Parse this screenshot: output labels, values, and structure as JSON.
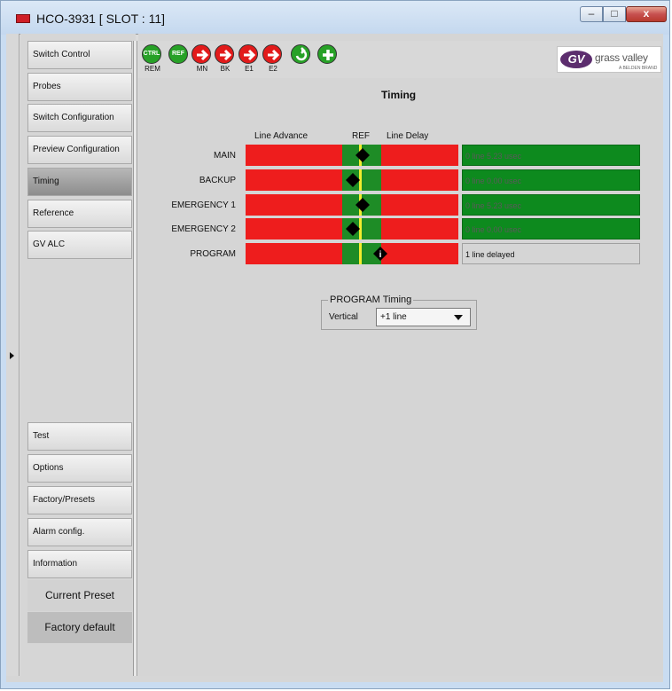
{
  "window": {
    "title": "HCO-3931 [ SLOT : 11]",
    "min_glyph": "–",
    "max_glyph": "□",
    "close_glyph": "x"
  },
  "nav": {
    "top_items": [
      {
        "label": "Switch Control",
        "active": false
      },
      {
        "label": "Probes",
        "active": false
      },
      {
        "label": "Switch Configuration",
        "active": false
      },
      {
        "label": "Preview Configuration",
        "active": false
      },
      {
        "label": "Timing",
        "active": true
      },
      {
        "label": "Reference",
        "active": false
      },
      {
        "label": "GV ALC",
        "active": false
      }
    ],
    "bottom_items": [
      {
        "label": "Test"
      },
      {
        "label": "Options"
      },
      {
        "label": "Factory/Presets"
      },
      {
        "label": "Alarm config."
      },
      {
        "label": "Information"
      }
    ],
    "current_preset": "Current Preset",
    "factory_default": "Factory default"
  },
  "toolbar": {
    "indicators": [
      {
        "name": "ctrl-indicator",
        "text": "CTRL",
        "label": "REM",
        "color": "#27a127",
        "icon": "circle-text"
      },
      {
        "name": "ref-indicator",
        "text": "REF",
        "label": "",
        "color": "#27a127",
        "icon": "circle-text"
      },
      {
        "name": "main-input-indicator",
        "text": "",
        "label": "MN",
        "color": "#e21b1b",
        "icon": "arrow-right"
      },
      {
        "name": "backup-input-indicator",
        "text": "",
        "label": "BK",
        "color": "#e21b1b",
        "icon": "arrow-right"
      },
      {
        "name": "emergency1-input-indicator",
        "text": "",
        "label": "E1",
        "color": "#e21b1b",
        "icon": "arrow-right"
      },
      {
        "name": "emergency2-input-indicator",
        "text": "",
        "label": "E2",
        "color": "#e21b1b",
        "icon": "arrow-right"
      },
      {
        "name": "refresh-indicator",
        "text": "",
        "label": "",
        "color": "#27a127",
        "icon": "refresh"
      },
      {
        "name": "add-indicator",
        "text": "",
        "label": "",
        "color": "#27a127",
        "icon": "plus"
      }
    ],
    "logo_mark": "GV",
    "logo_text": "grass valley",
    "logo_sub": "A BELDEN BRAND"
  },
  "timing": {
    "heading": "Timing",
    "col_line_advance": "Line Advance",
    "col_ref": "REF",
    "col_line_delay": "Line Delay",
    "rows": [
      {
        "label": "MAIN",
        "status": "0 line 5.23 usec",
        "status_kind": "ok",
        "marker": "diamond",
        "offset": "delay"
      },
      {
        "label": "BACKUP",
        "status": "0 line 0.00 usec",
        "status_kind": "ok",
        "marker": "diamond",
        "offset": "ref"
      },
      {
        "label": "EMERGENCY 1",
        "status": "0 line 5.23 usec",
        "status_kind": "ok",
        "marker": "diamond",
        "offset": "delay"
      },
      {
        "label": "EMERGENCY 2",
        "status": "0 line 0.00 usec",
        "status_kind": "ok",
        "marker": "diamond",
        "offset": "ref"
      },
      {
        "label": "PROGRAM",
        "status": "1 line delayed",
        "status_kind": "neutral",
        "marker": "info",
        "offset": "delay-1"
      }
    ]
  },
  "program_timing": {
    "group_title": "PROGRAM Timing",
    "vertical_label": "Vertical",
    "vertical_value": "+1 line"
  },
  "colors": {
    "red": "#ee1d1d",
    "green": "#1e8c26",
    "ref_line": "#f2ec2e",
    "status_green": "#0d8a1e"
  }
}
